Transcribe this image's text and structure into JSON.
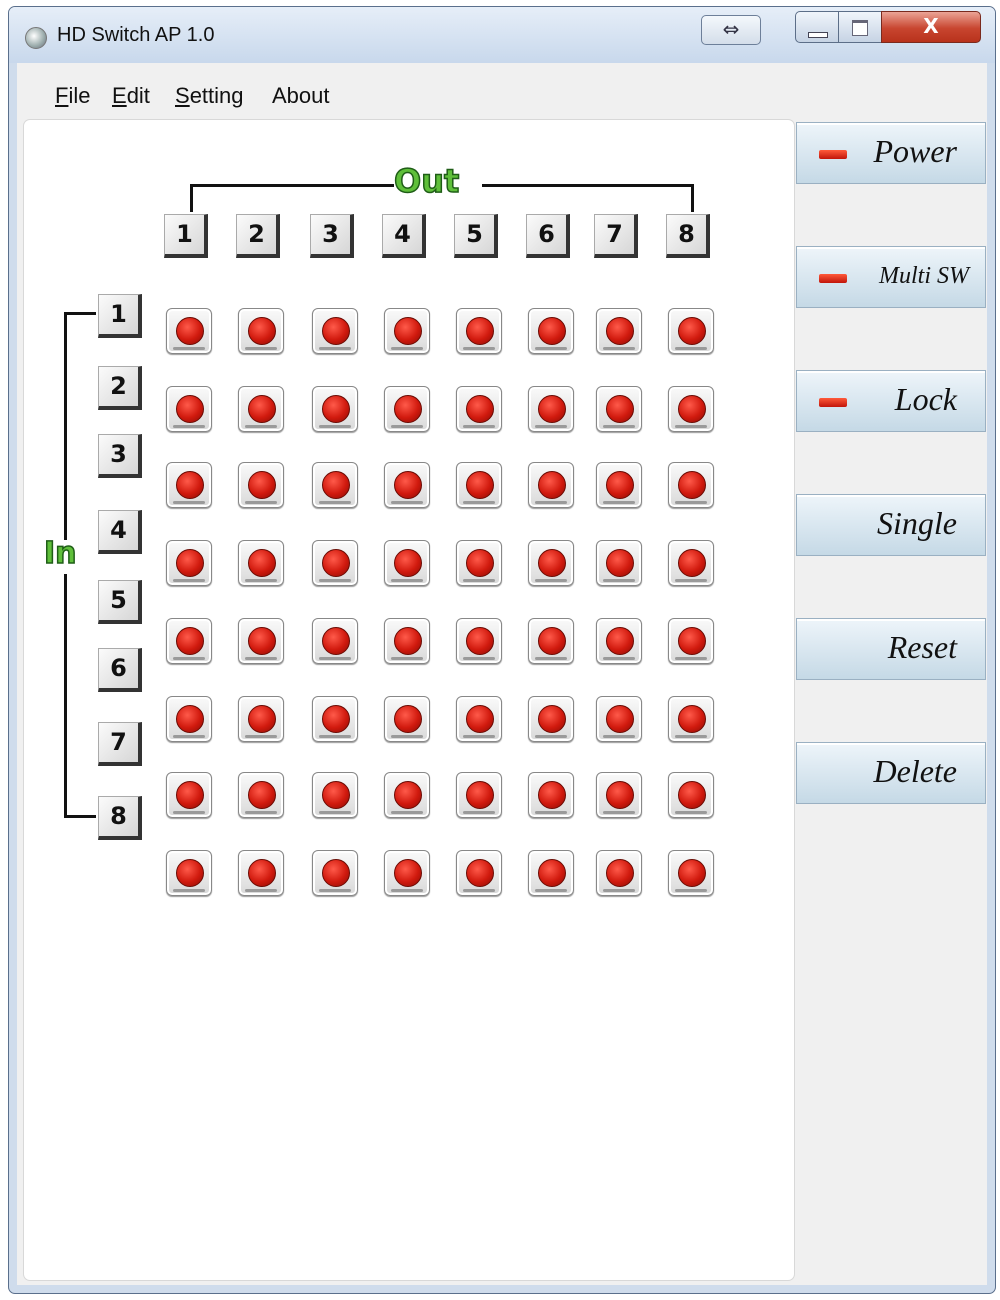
{
  "window": {
    "title": "HD Switch AP 1.0",
    "close_glyph": "X",
    "dock_glyph": "⇔"
  },
  "menu": [
    {
      "first": "F",
      "rest": "ile"
    },
    {
      "first": "E",
      "rest": "dit"
    },
    {
      "first": "S",
      "rest": "etting"
    },
    {
      "first": "",
      "rest": "About"
    }
  ],
  "matrix": {
    "out_label": "Out",
    "in_label": "In",
    "outputs": [
      "1",
      "2",
      "3",
      "4",
      "5",
      "6",
      "7",
      "8"
    ],
    "inputs": [
      "1",
      "2",
      "3",
      "4",
      "5",
      "6",
      "7",
      "8"
    ],
    "button_rows": 8,
    "led_color": "#d11a0e"
  },
  "side": {
    "power": "Power",
    "multi": "Multi SW",
    "lock": "Lock",
    "single": "Single",
    "reset": "Reset",
    "delete": "Delete",
    "indicator_color": "#e0281a"
  }
}
